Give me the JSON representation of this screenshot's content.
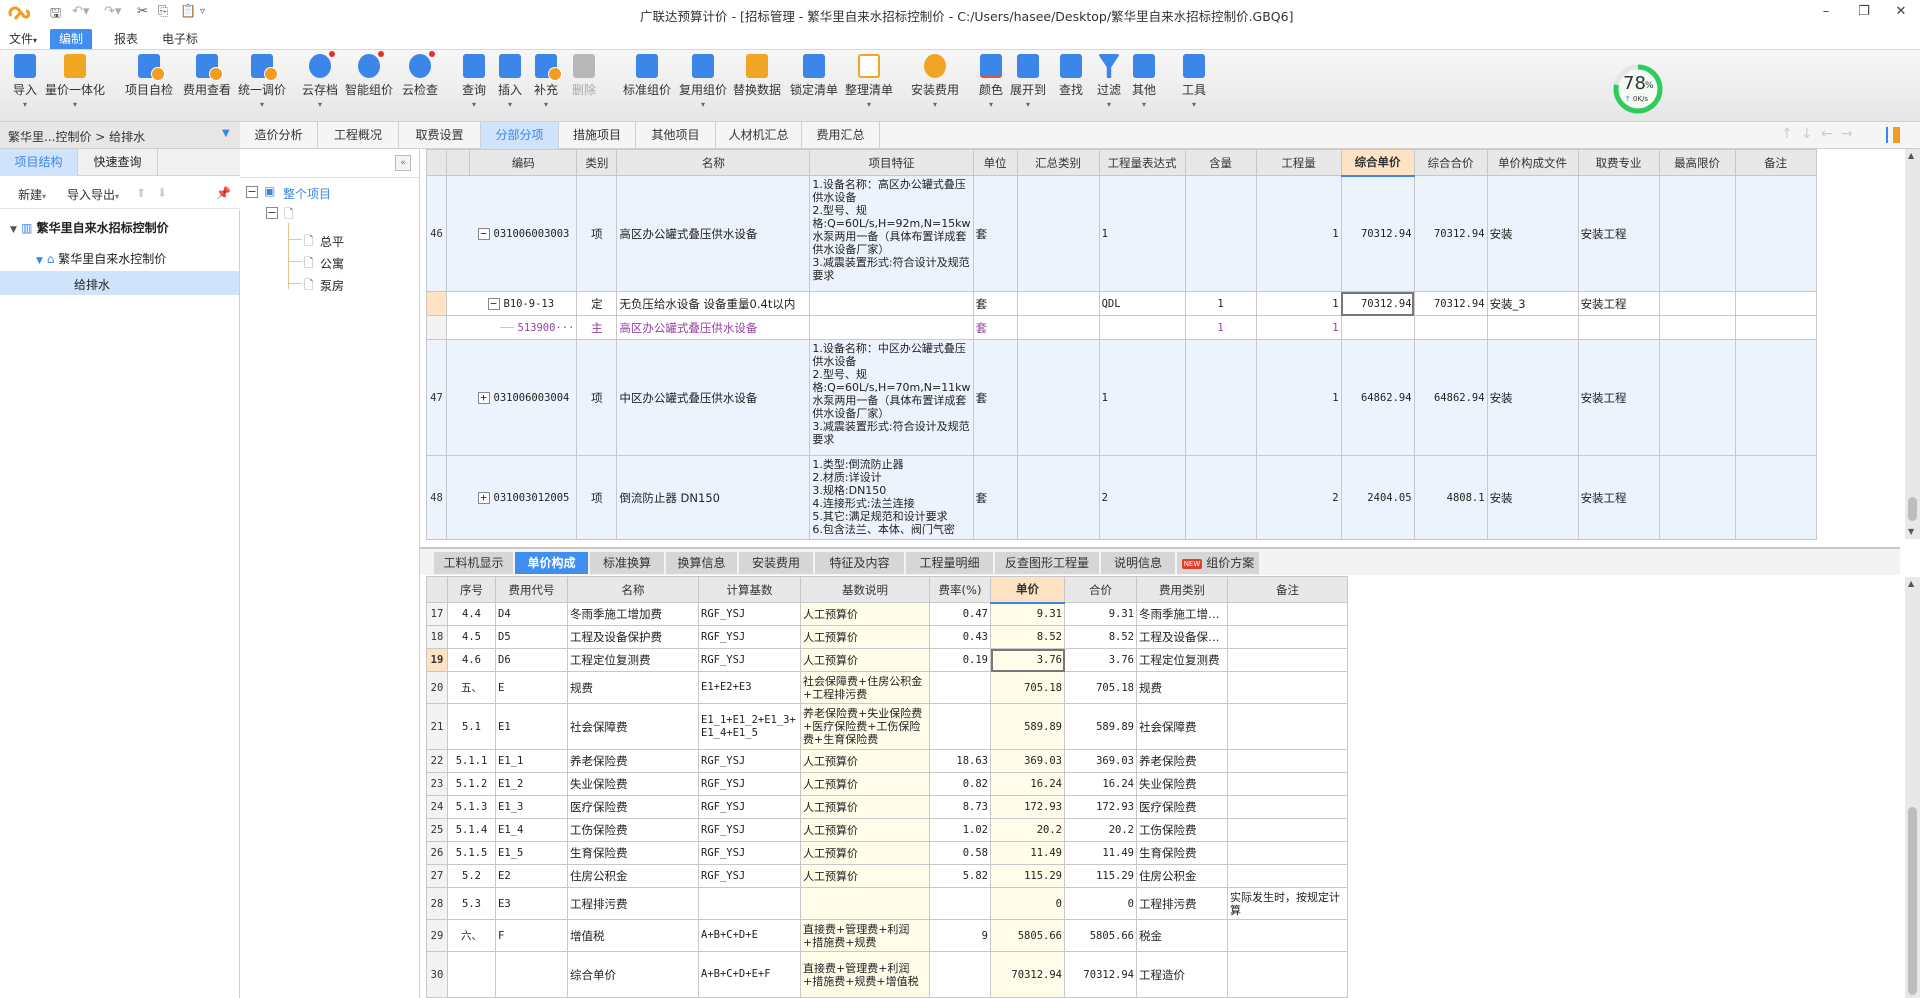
{
  "app": {
    "title": "广联达预算计价 - [招标管理 - 繁华里自来水招标控制价 - C:/Users/hasee/Desktop/繁华里自来水招标控制价.GBQ6]"
  },
  "menu": [
    "文件",
    "编制",
    "报表",
    "电子标"
  ],
  "ribbon": [
    {
      "label": "导入",
      "dropdown": true
    },
    {
      "label": "量价一体化",
      "dropdown": true
    },
    {
      "label": "项目自检",
      "dropdown": false
    },
    {
      "label": "费用查看",
      "dropdown": false
    },
    {
      "label": "统一调价",
      "dropdown": true
    },
    {
      "label": "云存档",
      "dropdown": true
    },
    {
      "label": "智能组价",
      "dropdown": false
    },
    {
      "label": "云检查",
      "dropdown": false
    },
    {
      "label": "查询",
      "dropdown": true
    },
    {
      "label": "插入",
      "dropdown": true
    },
    {
      "label": "补充",
      "dropdown": true
    },
    {
      "label": "删除",
      "dropdown": false,
      "disabled": true
    },
    {
      "label": "标准组价",
      "dropdown": false
    },
    {
      "label": "复用组价",
      "dropdown": true
    },
    {
      "label": "替换数据",
      "dropdown": false
    },
    {
      "label": "锁定清单",
      "dropdown": false
    },
    {
      "label": "整理清单",
      "dropdown": true
    },
    {
      "label": "安装费用",
      "dropdown": true
    },
    {
      "label": "颜色",
      "dropdown": true
    },
    {
      "label": "展开到",
      "dropdown": true
    },
    {
      "label": "查找",
      "dropdown": false
    },
    {
      "label": "过滤",
      "dropdown": true
    },
    {
      "label": "其他",
      "dropdown": true
    },
    {
      "label": "工具",
      "dropdown": true
    }
  ],
  "network": {
    "percent": "78",
    "percent_sign": "%",
    "progress": 0.78,
    "speed": "0K/s"
  },
  "breadcrumb": "繁华里...控制价 > 给排水",
  "side": {
    "tabs": [
      "项目结构",
      "快速查询"
    ],
    "toolbar": {
      "new": "新建",
      "import_export": "导入导出"
    },
    "tree": [
      {
        "label": "繁华里自来水招标控制价",
        "level": 0
      },
      {
        "label": "繁华里自来水控制价",
        "level": 1
      },
      {
        "label": "给排水",
        "level": 2,
        "selected": true
      }
    ]
  },
  "subtree": {
    "root": "整个项目",
    "children": [
      "总平",
      "公寓",
      "泵房"
    ]
  },
  "main_tabs": [
    "造价分析",
    "工程概况",
    "取费设置",
    "分部分项",
    "措施项目",
    "其他项目",
    "人材机汇总",
    "费用汇总"
  ],
  "active_main_tab": "分部分项",
  "upper_grid": {
    "columns": [
      "",
      "",
      "编码",
      "类别",
      "名称",
      "项目特征",
      "单位",
      "汇总类别",
      "工程量表达式",
      "含量",
      "工程量",
      "综合单价",
      "综合合价",
      "单价构成文件",
      "取费专业",
      "最高限价",
      "备注"
    ],
    "rows": [
      {
        "no": "46",
        "toggle": "−",
        "code": "031006003003",
        "type": "项",
        "name": "高区办公罐式叠压供水设备",
        "feature": "1.设备名称：高区办公罐式叠压供水设备\n2.型号、规格:Q=60L/s,H=92m,N=15kw水泵两用一备（具体布置详成套供水设备厂家）\n3.减震装置形式:符合设计及规范要求",
        "unit": "套",
        "sum_type": "",
        "expr": "1",
        "content": "",
        "qty": "1",
        "unit_price": "70312.94",
        "total": "70312.94",
        "price_file": "安装",
        "fee_major": "安装工程",
        "max_price": "",
        "remark": ""
      },
      {
        "no": "",
        "toggle": "−",
        "code": "B10-9-13",
        "type": "定",
        "name": "无负压给水设备 设备重量0.4t以内",
        "feature": "",
        "unit": "套",
        "sum_type": "",
        "expr": "QDL",
        "content": "1",
        "qty": "1",
        "unit_price": "70312.94",
        "total": "70312.94",
        "price_file": "安装_3",
        "fee_major": "安装工程",
        "max_price": "",
        "remark": ""
      },
      {
        "no": "",
        "toggle": "",
        "code": "513900···",
        "type": "主",
        "name": "高区办公罐式叠压供水设备",
        "feature": "",
        "unit": "套",
        "sum_type": "",
        "expr": "",
        "content": "1",
        "qty": "1",
        "unit_price": "",
        "total": "",
        "price_file": "",
        "fee_major": "",
        "max_price": "",
        "remark": ""
      },
      {
        "no": "47",
        "toggle": "+",
        "code": "031006003004",
        "type": "项",
        "name": "中区办公罐式叠压供水设备",
        "feature": "1.设备名称：中区办公罐式叠压供水设备\n2.型号、规格:Q=60L/s,H=70m,N=11kw水泵两用一备（具体布置详成套供水设备厂家）\n3.减震装置形式:符合设计及规范要求",
        "unit": "套",
        "sum_type": "",
        "expr": "1",
        "content": "",
        "qty": "1",
        "unit_price": "64862.94",
        "total": "64862.94",
        "price_file": "安装",
        "fee_major": "安装工程",
        "max_price": "",
        "remark": ""
      },
      {
        "no": "48",
        "toggle": "+",
        "code": "031003012005",
        "type": "项",
        "name": "倒流防止器 DN150",
        "feature": "1.类型:倒流防止器\n2.材质:详设计\n3.规格:DN150\n4.连接形式:法兰连接\n5.其它:满足规范和设计要求\n6.包含法兰、本体、阀门气密",
        "unit": "套",
        "sum_type": "",
        "expr": "2",
        "content": "",
        "qty": "2",
        "unit_price": "2404.05",
        "total": "4808.1",
        "price_file": "安装",
        "fee_major": "安装工程",
        "max_price": "",
        "remark": ""
      }
    ]
  },
  "bottom_tabs": [
    "工料机显示",
    "单价构成",
    "标准换算",
    "换算信息",
    "安装费用",
    "特征及内容",
    "工程量明细",
    "反查图形工程量",
    "说明信息",
    "组价方案"
  ],
  "active_bottom_tab": "单价构成",
  "new_badge": "NEW",
  "lower_grid": {
    "columns": [
      "",
      "序号",
      "费用代号",
      "名称",
      "计算基数",
      "基数说明",
      "费率(%)",
      "单价",
      "合价",
      "费用类别",
      "备注"
    ],
    "rows": [
      {
        "n": "17",
        "seq": "4.4",
        "code": "D4",
        "name": "冬雨季施工增加费",
        "base": "RGF_YSJ",
        "desc": "人工预算价",
        "rate": "0.47",
        "price": "9.31",
        "total": "9.31",
        "cat": "冬雨季施工增…",
        "remark": ""
      },
      {
        "n": "18",
        "seq": "4.5",
        "code": "D5",
        "name": "工程及设备保护费",
        "base": "RGF_YSJ",
        "desc": "人工预算价",
        "rate": "0.43",
        "price": "8.52",
        "total": "8.52",
        "cat": "工程及设备保…",
        "remark": ""
      },
      {
        "n": "19",
        "seq": "4.6",
        "code": "D6",
        "name": "工程定位复测费",
        "base": "RGF_YSJ",
        "desc": "人工预算价",
        "rate": "0.19",
        "price": "3.76",
        "total": "3.76",
        "cat": "工程定位复测费",
        "remark": "",
        "selected": true
      },
      {
        "n": "20",
        "seq": "五、",
        "code": "E",
        "name": "规费",
        "base": "E1+E2+E3",
        "desc": "社会保障费+住房公积金+工程排污费",
        "rate": "",
        "price": "705.18",
        "total": "705.18",
        "cat": "规费",
        "remark": ""
      },
      {
        "n": "21",
        "seq": "5.1",
        "code": "E1",
        "name": "社会保障费",
        "base": "E1_1+E1_2+E1_3+E1_4+E1_5",
        "desc": "养老保险费+失业保险费+医疗保险费+工伤保险费+生育保险费",
        "rate": "",
        "price": "589.89",
        "total": "589.89",
        "cat": "社会保障费",
        "remark": ""
      },
      {
        "n": "22",
        "seq": "5.1.1",
        "code": "E1_1",
        "name": "养老保险费",
        "base": "RGF_YSJ",
        "desc": "人工预算价",
        "rate": "18.63",
        "price": "369.03",
        "total": "369.03",
        "cat": "养老保险费",
        "remark": ""
      },
      {
        "n": "23",
        "seq": "5.1.2",
        "code": "E1_2",
        "name": "失业保险费",
        "base": "RGF_YSJ",
        "desc": "人工预算价",
        "rate": "0.82",
        "price": "16.24",
        "total": "16.24",
        "cat": "失业保险费",
        "remark": ""
      },
      {
        "n": "24",
        "seq": "5.1.3",
        "code": "E1_3",
        "name": "医疗保险费",
        "base": "RGF_YSJ",
        "desc": "人工预算价",
        "rate": "8.73",
        "price": "172.93",
        "total": "172.93",
        "cat": "医疗保险费",
        "remark": ""
      },
      {
        "n": "25",
        "seq": "5.1.4",
        "code": "E1_4",
        "name": "工伤保险费",
        "base": "RGF_YSJ",
        "desc": "人工预算价",
        "rate": "1.02",
        "price": "20.2",
        "total": "20.2",
        "cat": "工伤保险费",
        "remark": ""
      },
      {
        "n": "26",
        "seq": "5.1.5",
        "code": "E1_5",
        "name": "生育保险费",
        "base": "RGF_YSJ",
        "desc": "人工预算价",
        "rate": "0.58",
        "price": "11.49",
        "total": "11.49",
        "cat": "生育保险费",
        "remark": ""
      },
      {
        "n": "27",
        "seq": "5.2",
        "code": "E2",
        "name": "住房公积金",
        "base": "RGF_YSJ",
        "desc": "人工预算价",
        "rate": "5.82",
        "price": "115.29",
        "total": "115.29",
        "cat": "住房公积金",
        "remark": ""
      },
      {
        "n": "28",
        "seq": "5.3",
        "code": "E3",
        "name": "工程排污费",
        "base": "",
        "desc": "",
        "rate": "",
        "price": "0",
        "total": "0",
        "cat": "工程排污费",
        "remark": "实际发生时，按规定计算"
      },
      {
        "n": "29",
        "seq": "六、",
        "code": "F",
        "name": "增值税",
        "base": "A+B+C+D+E",
        "desc": "直接费+管理费+利润+措施费+规费",
        "rate": "9",
        "price": "5805.66",
        "total": "5805.66",
        "cat": "税金",
        "remark": ""
      },
      {
        "n": "30",
        "seq": "",
        "code": "",
        "name": "综合单价",
        "base": "A+B+C+D+E+F",
        "desc": "直接费+管理费+利润+措施费+规费+增值税",
        "rate": "",
        "price": "70312.94",
        "total": "70312.94",
        "cat": "工程造价",
        "remark": ""
      }
    ]
  },
  "colors": {
    "accent": "#3f8ef0",
    "highlight": "#fde3c4",
    "row_blue": "#edf3fd",
    "main_material": "#9a3fa8",
    "progress_green": "#2ecc5a"
  }
}
